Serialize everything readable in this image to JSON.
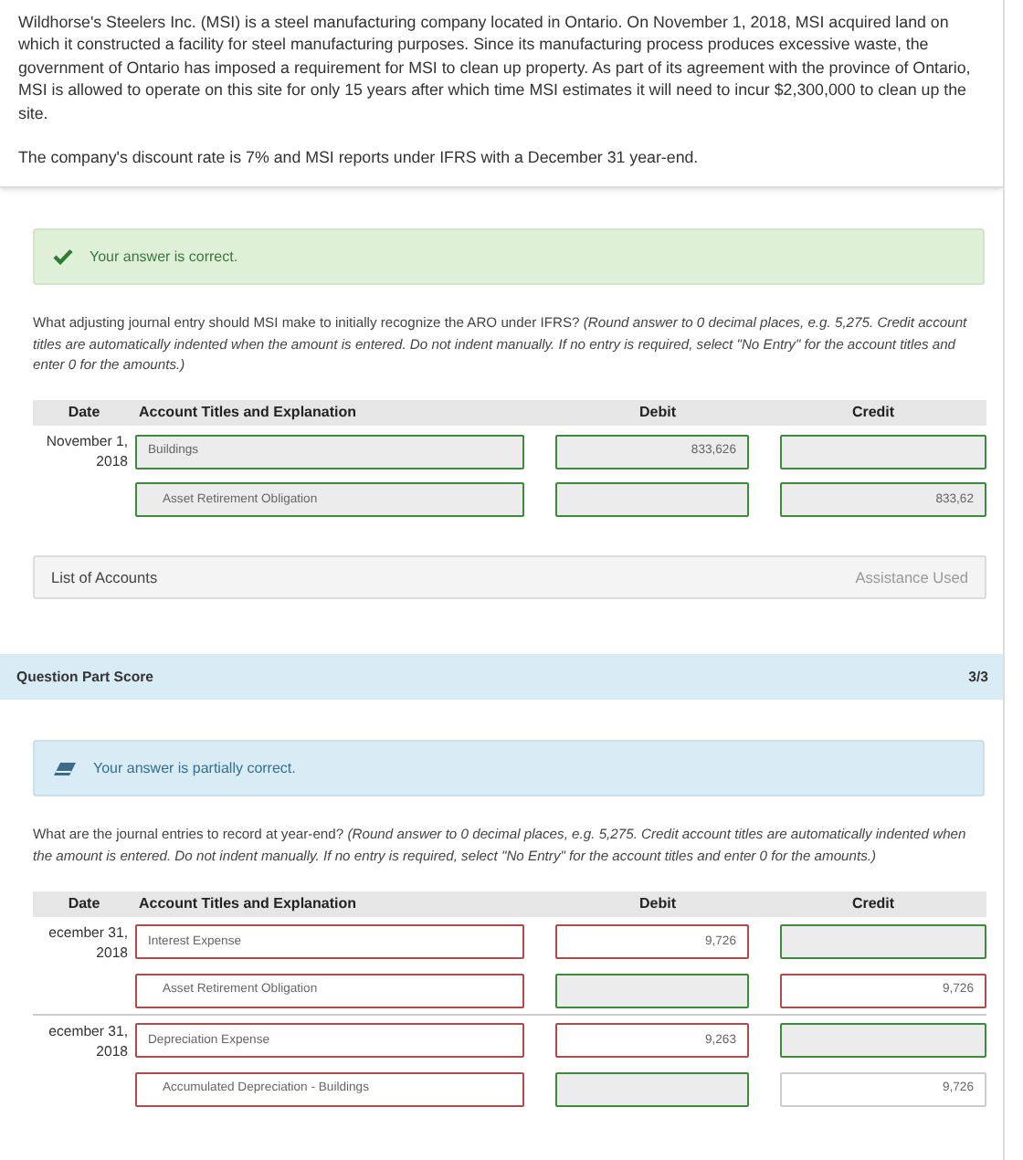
{
  "problem": {
    "paragraphs": [
      "Wildhorse's Steelers Inc. (MSI) is a steel manufacturing company located in Ontario. On November 1, 2018, MSI acquired land on which it constructed a facility for steel manufacturing purposes. Since its manufacturing process produces excessive waste, the government of Ontario has imposed a requirement for MSI to clean up property. As part of its agreement with the province of Ontario, MSI is allowed to operate on this site for only 15 years after which time MSI estimates it will need to incur $2,300,000 to clean up the site.",
      "The company's discount rate is 7% and MSI reports under IFRS with a December 31 year-end."
    ]
  },
  "parts": [
    {
      "result": {
        "kind": "correct",
        "message": "Your answer is correct."
      },
      "question": "What adjusting journal entry should MSI make to initially recognize the ARO under IFRS? *(Round answer to 0 decimal places, e.g. 5,275. Credit account titles are automatically indented when the amount is entered. Do not indent manually. If no entry is required, select \"No Entry\" for the account titles and enter 0 for the amounts.)*",
      "table": {
        "columns": [
          "Date",
          "Account Titles and Explanation",
          "Debit",
          "Credit"
        ],
        "entries": [
          {
            "date": "November 1, 2018",
            "lines": [
              {
                "indented": false,
                "account": {
                  "value": "Buildings",
                  "graded": true,
                  "correct": true
                },
                "debit": {
                  "value": "833,626",
                  "graded": true,
                  "correct": true
                },
                "credit": {
                  "graded": true,
                  "correct": true
                }
              },
              {
                "indented": true,
                "account": {
                  "value": "Asset Retirement Obligation",
                  "graded": true,
                  "correct": true
                },
                "debit": {
                  "graded": true,
                  "correct": true
                },
                "credit": {
                  "value": "833,62",
                  "graded": true,
                  "correct": true
                }
              }
            ]
          }
        ]
      },
      "footer": {
        "link": "List of Accounts",
        "note": "Assistance Used"
      },
      "score": {
        "label": "Question Part Score",
        "value": "3/3"
      }
    },
    {
      "result": {
        "kind": "partial",
        "message": "Your answer is partially correct."
      },
      "question": "What are the journal entries to record at year-end? *(Round answer to 0 decimal places, e.g. 5,275. Credit account titles are automatically indented when the amount is entered. Do not indent manually. If no entry is required, select \"No Entry\" for the account titles and enter 0 for the amounts.)*",
      "table": {
        "columns": [
          "Date",
          "Account Titles and Explanation",
          "Debit",
          "Credit"
        ],
        "entries": [
          {
            "date": "ecember 31, 2018",
            "lines": [
              {
                "indented": false,
                "account": {
                  "value": "Interest Expense",
                  "graded": true,
                  "correct": false
                },
                "debit": {
                  "value": "9,726",
                  "graded": true,
                  "correct": false
                },
                "credit": {
                  "graded": true,
                  "correct": true
                }
              },
              {
                "indented": true,
                "account": {
                  "value": "Asset Retirement Obligation",
                  "graded": true,
                  "correct": false
                },
                "debit": {
                  "graded": true,
                  "correct": true
                },
                "credit": {
                  "value": "9,726",
                  "graded": true,
                  "correct": false
                }
              }
            ]
          },
          {
            "date": "ecember 31, 2018",
            "lines": [
              {
                "indented": false,
                "account": {
                  "value": "Depreciation Expense",
                  "graded": true,
                  "correct": false
                },
                "debit": {
                  "value": "9,263",
                  "graded": true,
                  "correct": false
                },
                "credit": {
                  "graded": true,
                  "correct": true
                }
              },
              {
                "indented": true,
                "account": {
                  "value": "Accumulated Depreciation - Buildings",
                  "graded": true,
                  "correct": false
                },
                "debit": {
                  "graded": true,
                  "correct": true
                },
                "credit": {
                  "value": "9,726",
                  "graded": false
                }
              }
            ]
          }
        ]
      }
    }
  ]
}
